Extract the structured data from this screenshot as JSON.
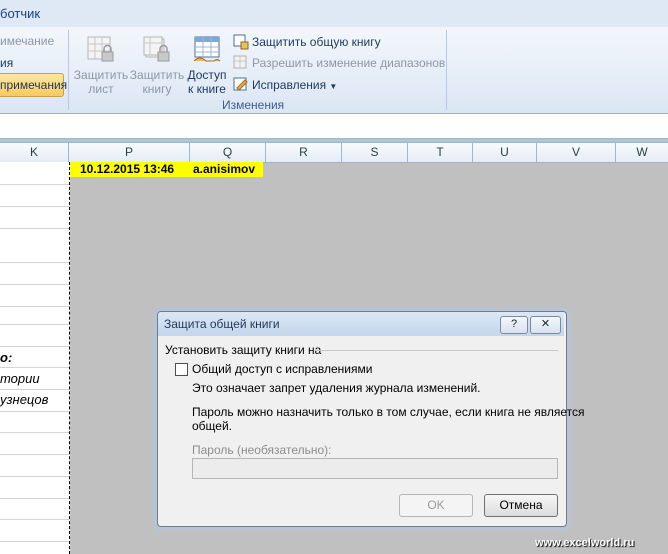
{
  "ribbon": {
    "tab_label": "ботчик",
    "left_items": [
      "имечание",
      "ия",
      "примечания"
    ],
    "protect_sheet": "Защитить\nлист",
    "protect_book": "Защитить\nкнигу",
    "access_book": "Доступ\nк книге",
    "protect_shared": "Защитить общую книгу",
    "allow_ranges": "Разрешить изменение диапазонов",
    "track_changes": "Исправления",
    "group_label": "Изменения"
  },
  "columns": [
    "K",
    "P",
    "Q",
    "R",
    "S",
    "T",
    "U",
    "V",
    "W"
  ],
  "cells": {
    "datetime": "10.12.2015 13:46",
    "user": "a.anisimov",
    "left_texts": [
      "о:",
      "тории",
      "узнецов"
    ]
  },
  "dialog": {
    "title": "Защита общей книги",
    "help": "?",
    "close": "✕",
    "section": "Установить защиту книги на",
    "checkbox_label": "Общий доступ с исправлениями",
    "checkbox_checked": false,
    "info": "Это означает запрет удаления журнала изменений.",
    "note_line1": "Пароль можно назначить только в том случае, если книга не является",
    "note_line2": "общей.",
    "password_label": "Пароль (необязательно):",
    "password_value": "",
    "ok": "OK",
    "cancel": "Отмена"
  },
  "watermark": "www.excelworld.ru"
}
